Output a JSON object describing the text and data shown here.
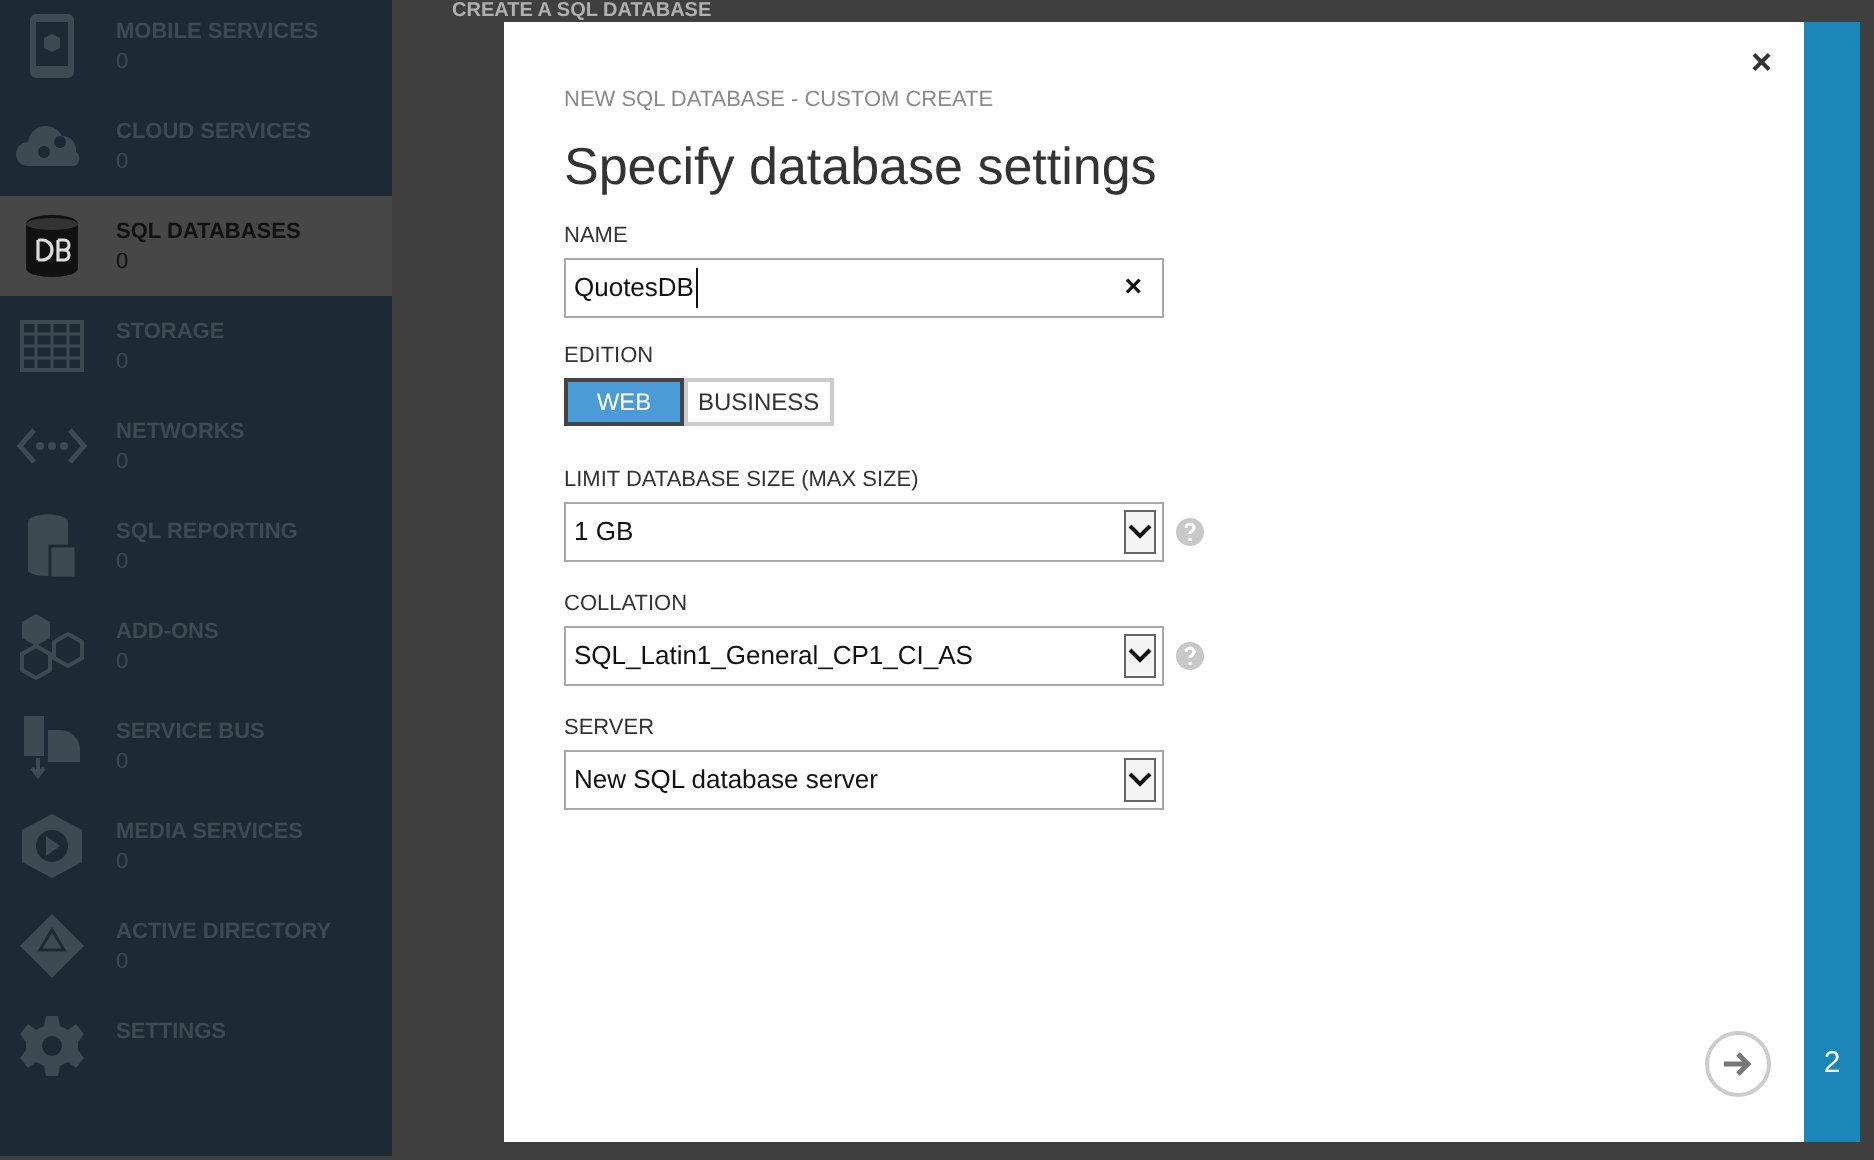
{
  "sidebar": {
    "items": [
      {
        "kind": "mobile",
        "label": "MOBILE SERVICES",
        "count": "0",
        "selected": false
      },
      {
        "kind": "cloud",
        "label": "CLOUD SERVICES",
        "count": "0",
        "selected": false
      },
      {
        "kind": "database",
        "label": "SQL DATABASES",
        "count": "0",
        "selected": true
      },
      {
        "kind": "storage",
        "label": "STORAGE",
        "count": "0",
        "selected": false
      },
      {
        "kind": "network",
        "label": "NETWORKS",
        "count": "0",
        "selected": false
      },
      {
        "kind": "report",
        "label": "SQL REPORTING",
        "count": "0",
        "selected": false
      },
      {
        "kind": "addons",
        "label": "ADD-ONS",
        "count": "0",
        "selected": false
      },
      {
        "kind": "bus",
        "label": "SERVICE BUS",
        "count": "0",
        "selected": false
      },
      {
        "kind": "media",
        "label": "MEDIA SERVICES",
        "count": "0",
        "selected": false
      },
      {
        "kind": "directory",
        "label": "ACTIVE DIRECTORY",
        "count": "0",
        "selected": false
      },
      {
        "kind": "settings",
        "label": "SETTINGS",
        "selected": false
      }
    ]
  },
  "page_title": "CREATE A SQL DATABASE",
  "dialog": {
    "close": "×",
    "subtitle": "NEW SQL DATABASE - CUSTOM CREATE",
    "title": "Specify database settings",
    "name_field": {
      "label": "NAME",
      "value": "QuotesDB",
      "clear": "×"
    },
    "edition": {
      "label": "EDITION",
      "options": [
        {
          "label": "WEB",
          "selected": true
        },
        {
          "label": "BUSINESS",
          "selected": false
        }
      ]
    },
    "selects": [
      {
        "label": "LIMIT DATABASE SIZE (MAX SIZE)",
        "value": "1 GB",
        "help": true
      },
      {
        "label": "COLLATION",
        "value": "SQL_Latin1_General_CP1_CI_AS",
        "help": true
      },
      {
        "label": "SERVER",
        "value": "New SQL database server",
        "help": false
      }
    ],
    "step": "2"
  }
}
